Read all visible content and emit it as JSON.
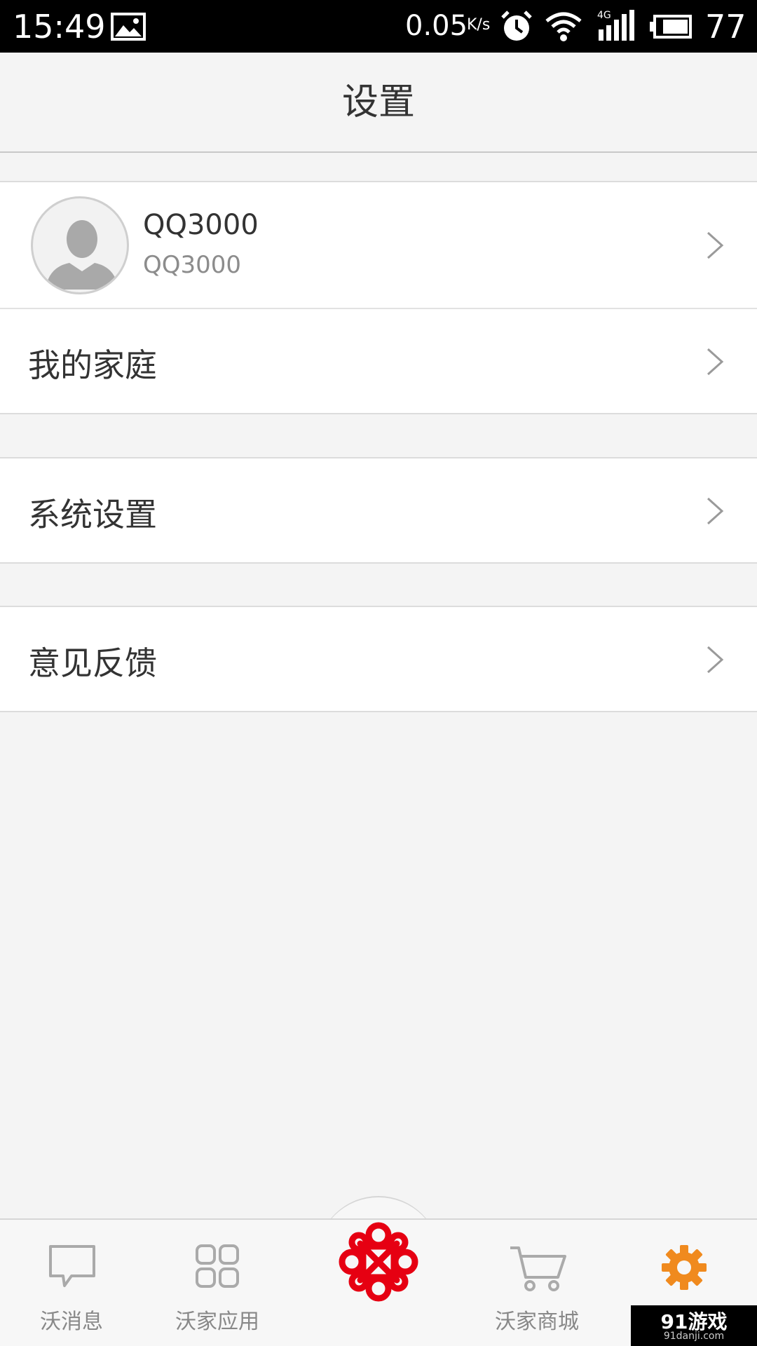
{
  "status_bar": {
    "time": "15:49",
    "net_speed": "0.05",
    "net_unit": "K/s",
    "battery_level": "77",
    "icons": [
      "image-icon",
      "alarm-icon",
      "wifi-icon",
      "signal-4g-icon",
      "battery-icon"
    ],
    "network_label": "4G"
  },
  "header": {
    "title": "设置"
  },
  "profile": {
    "name": "QQ3000",
    "id": "QQ3000"
  },
  "menu": {
    "family": "我的家庭",
    "system_settings": "系统设置",
    "feedback": "意见反馈"
  },
  "bottom_nav": {
    "items": [
      {
        "label": "沃消息",
        "icon": "chat-bubble-icon",
        "active": false
      },
      {
        "label": "沃家应用",
        "icon": "grid-icon",
        "active": false
      },
      {
        "label": "",
        "icon": "china-unicom-logo",
        "active": false
      },
      {
        "label": "沃家商城",
        "icon": "cart-icon",
        "active": false
      },
      {
        "label": "设置",
        "icon": "gear-icon",
        "active": true
      }
    ]
  },
  "watermark": {
    "main": "91游戏",
    "sub": "91danji.com"
  },
  "colors": {
    "accent": "#f08a1e",
    "logo_red": "#e60012",
    "background": "#f4f4f4"
  }
}
